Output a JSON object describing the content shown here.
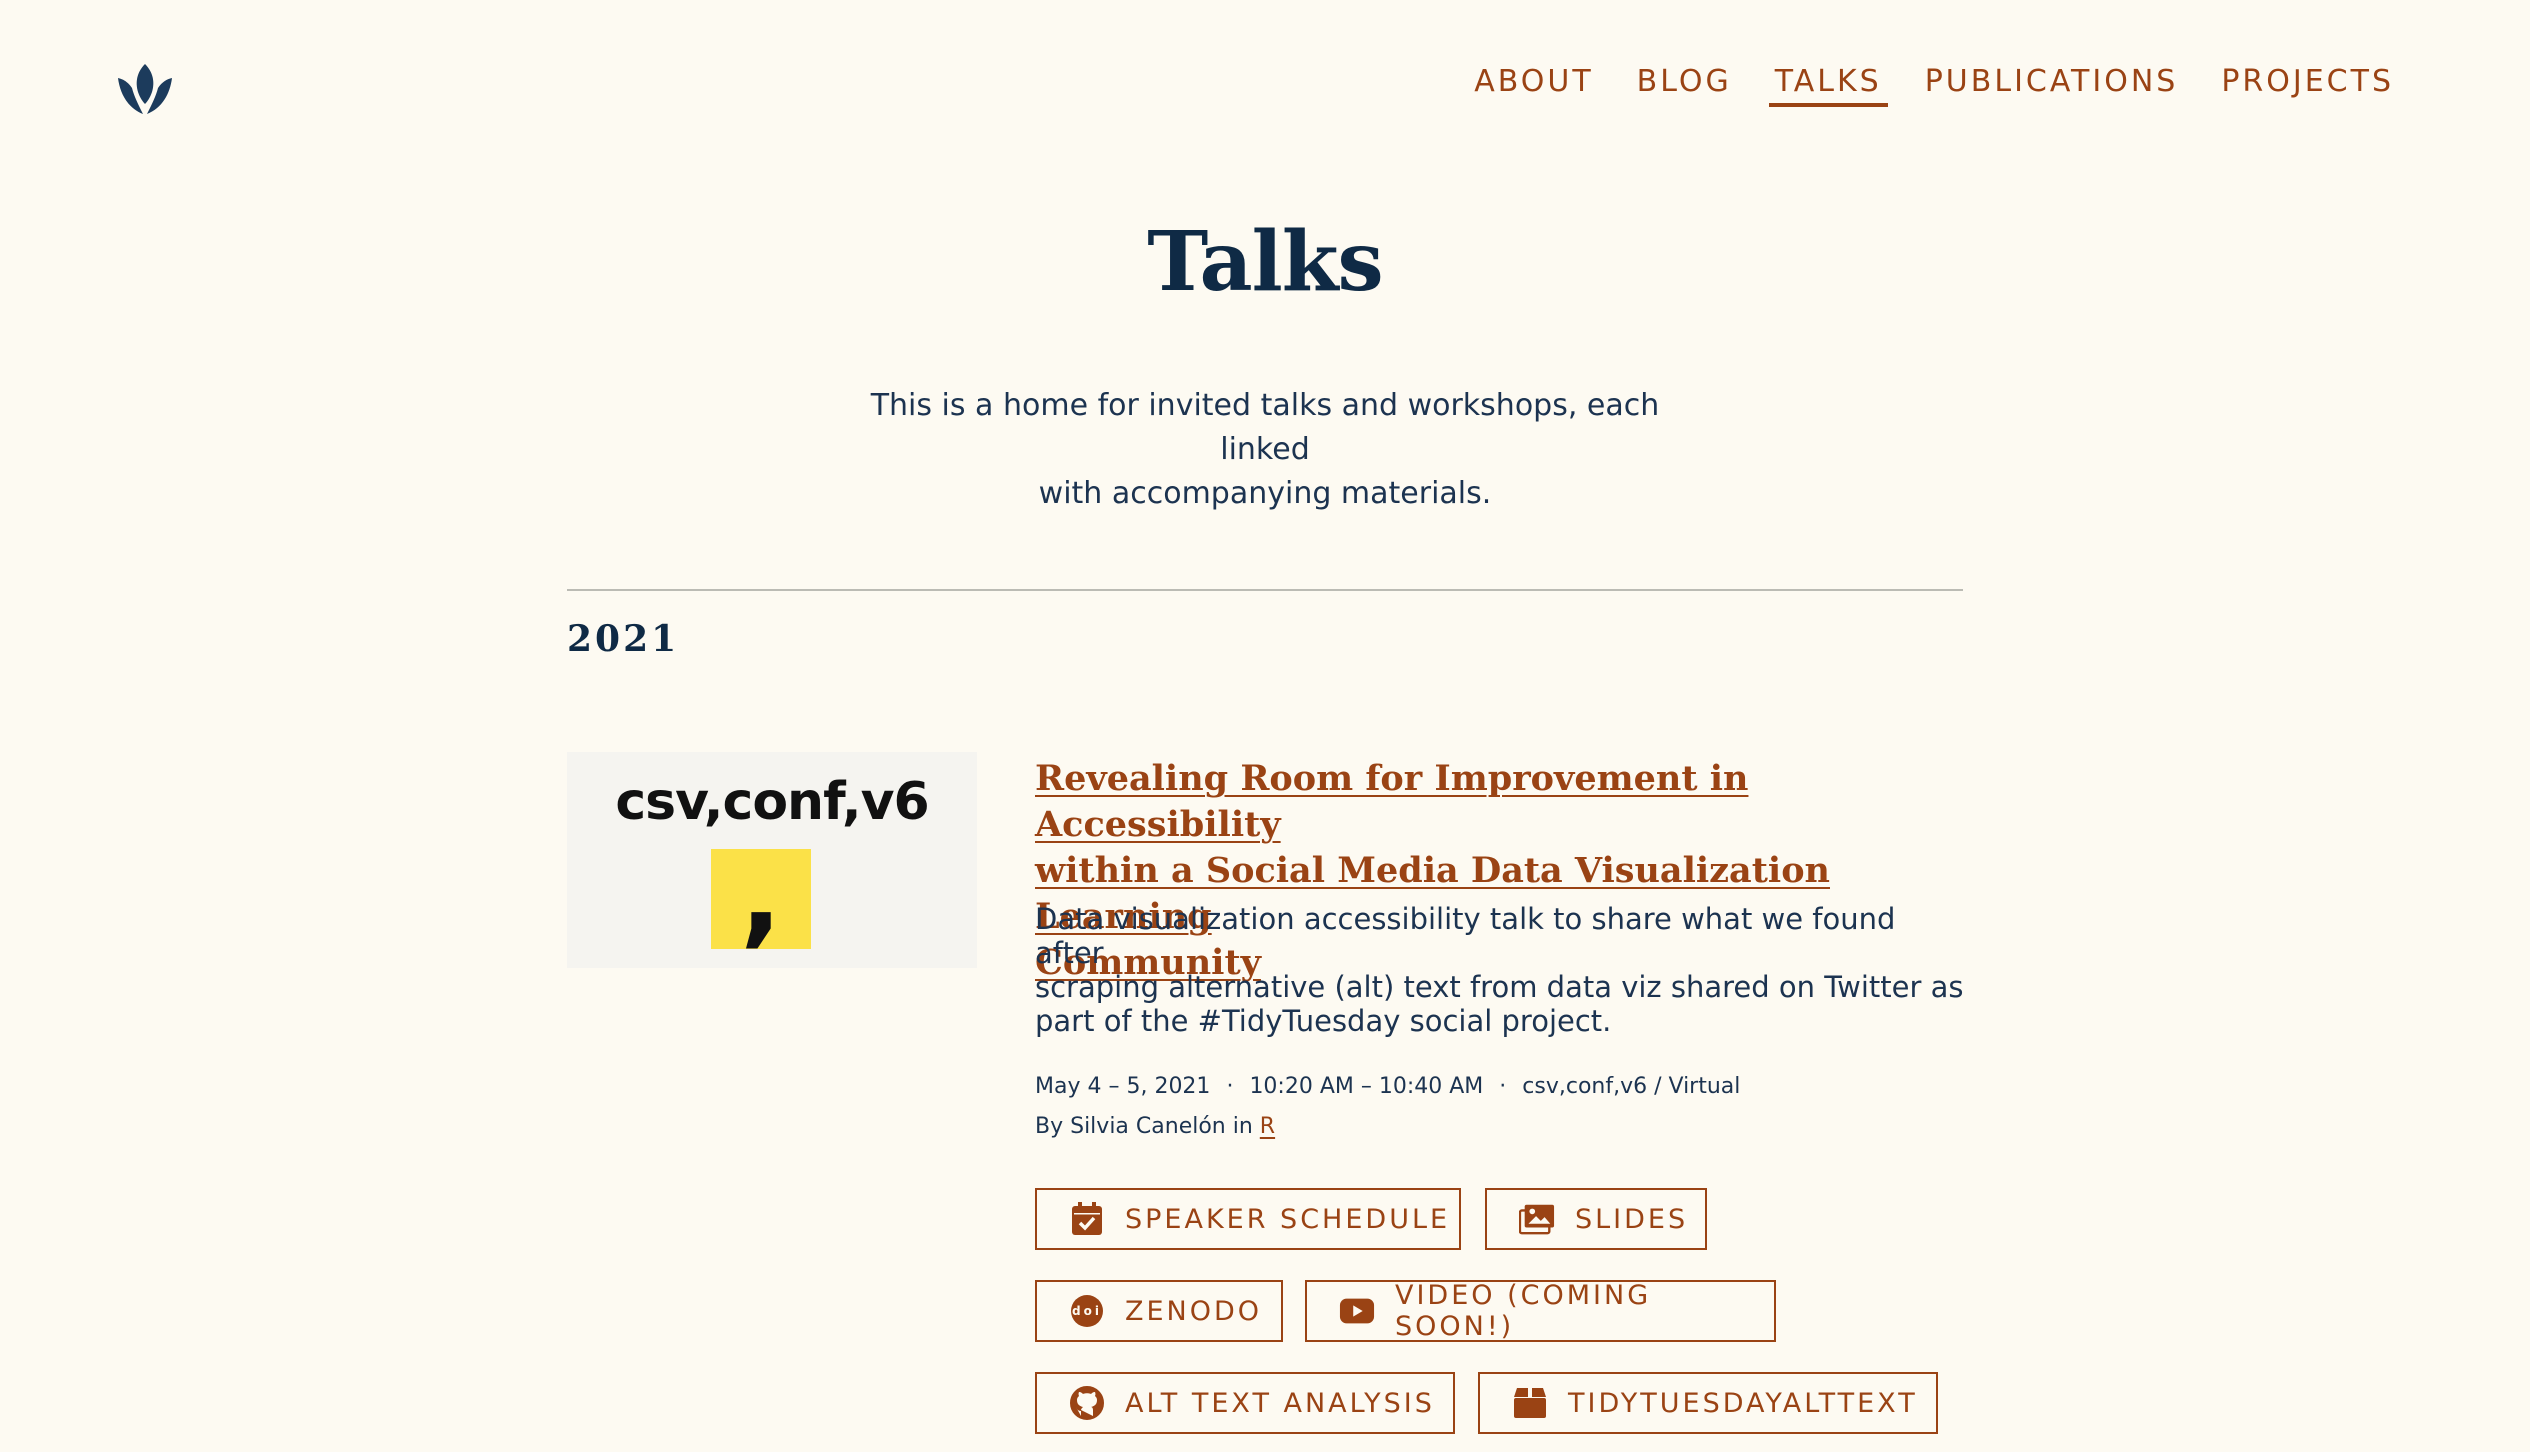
{
  "nav": {
    "items": [
      "ABOUT",
      "BLOG",
      "TALKS",
      "PUBLICATIONS",
      "PROJECTS"
    ],
    "active": "TALKS"
  },
  "page": {
    "title": "Talks",
    "intro_line1": "This is a home for invited talks and workshops, each linked",
    "intro_line2": "with accompanying materials."
  },
  "year": "2021",
  "talk": {
    "thumbnail_text": "csv,conf,v6",
    "thumbnail_mark": ",",
    "title_line1": "Revealing Room for Improvement in Accessibility",
    "title_line2": "within a Social Media Data Visualization Learning",
    "title_line3": "Community",
    "desc_line1": "Data visualization accessibility talk to share what we found after",
    "desc_line2": "scraping alternative (alt) text from data viz shared on Twitter as",
    "desc_line3": "part of the #TidyTuesday social project.",
    "date": "May 4 – 5, 2021",
    "time": "10:20 AM – 10:40 AM",
    "location": "csv,conf,v6 / Virtual",
    "byline_prefix": "By Silvia Canelón in",
    "category": "R",
    "separator": "·",
    "buttons": [
      {
        "label": "SPEAKER SCHEDULE",
        "icon": "calendar-check-icon"
      },
      {
        "label": "SLIDES",
        "icon": "images-icon"
      },
      {
        "label": "ZENODO",
        "icon": "doi-icon"
      },
      {
        "label": "VIDEO (COMING SOON!)",
        "icon": "youtube-icon"
      },
      {
        "label": "ALT TEXT ANALYSIS",
        "icon": "github-icon"
      },
      {
        "label": "TIDYTUESDAYALTTEXT",
        "icon": "box-icon"
      }
    ]
  },
  "colors": {
    "background": "#fdfaf2",
    "accent": "#9a4314",
    "heading": "#0f2a45",
    "text": "#1c3350",
    "thumb_yellow": "#fbe148"
  }
}
